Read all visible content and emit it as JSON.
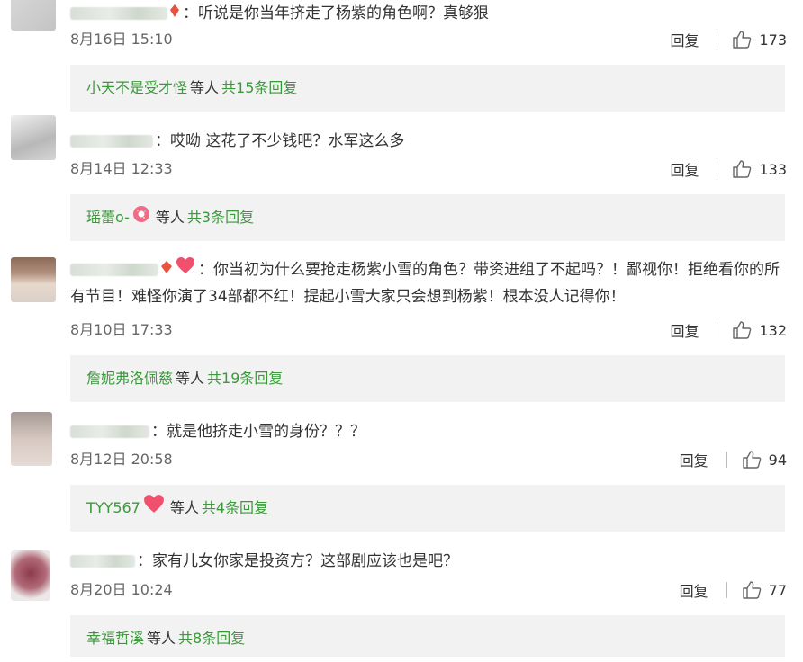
{
  "reply_label": "回复",
  "etc_label": "等人",
  "comments": [
    {
      "text": "：听说是你当年挤走了杨紫的角色啊？真够狠",
      "time": "8月16日 15:10",
      "likes": "173",
      "sub_user": "小天不是受才怪",
      "sub_count": "共15条回复"
    },
    {
      "text": "：哎呦 这花了不少钱吧？水军这么多",
      "time": "8月14日 12:33",
      "likes": "133",
      "sub_user": "瑶蕾o-",
      "sub_count": "共3条回复"
    },
    {
      "text": "：你当初为什么要抢走杨紫小雪的角色？带资进组了不起吗？！鄙视你！拒绝看你的所有节目！难怪你演了34部都不红！提起小雪大家只会想到杨紫！根本没人记得你！",
      "time": "8月10日 17:33",
      "likes": "132",
      "sub_user": "詹妮弗洛佩慈",
      "sub_count": "共19条回复"
    },
    {
      "text": "：就是他挤走小雪的身份？？？",
      "time": "8月12日 20:58",
      "likes": "94",
      "sub_user": "TYY567",
      "sub_count": "共4条回复"
    },
    {
      "text": "：家有儿女你家是投资方？这部剧应该也是吧？",
      "time": "8月20日 10:24",
      "likes": "77",
      "sub_user": "幸福哲溪",
      "sub_count": "共8条回复"
    }
  ],
  "colors": {
    "accent_green": "#3a9a3a",
    "subbox_bg": "#f2f2f2",
    "heart": "#f0506e"
  }
}
